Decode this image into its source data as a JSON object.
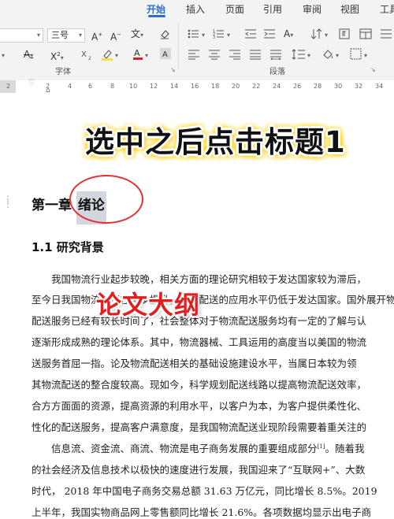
{
  "tabs": [
    {
      "label": "开始",
      "active": true
    },
    {
      "label": "插入",
      "active": false
    },
    {
      "label": "页面",
      "active": false
    },
    {
      "label": "引用",
      "active": false
    },
    {
      "label": "审阅",
      "active": false
    },
    {
      "label": "视图",
      "active": false
    },
    {
      "label": "工具",
      "active": false
    }
  ],
  "ribbon": {
    "font_size": "三号",
    "font_group_label": "字体",
    "paragraph_group_label": "段落",
    "icons": [
      "increase-font-icon",
      "decrease-font-icon",
      "phonetic-guide-icon",
      "clear-format-icon",
      "bullet-list-icon",
      "numbered-list-icon",
      "decrease-indent-icon",
      "increase-indent-icon",
      "text-direction-icon",
      "sort-icon",
      "show-marks-icon",
      "strikethrough-icon",
      "superscript-icon",
      "highlight-icon",
      "font-color-icon",
      "char-shading-icon",
      "align-left-icon",
      "align-center-icon",
      "align-right-icon",
      "justify-icon",
      "distributed-icon",
      "line-spacing-icon",
      "shading-icon",
      "border-icon"
    ],
    "font_color": "#e02020",
    "highlight_color": "#f5e04a"
  },
  "ruler": {
    "ticks": [
      "2",
      "2",
      "4",
      "6",
      "8",
      "10",
      "12",
      "14",
      "16",
      "18",
      "20",
      "22",
      "24",
      "26",
      "28",
      "30",
      "32",
      "34"
    ]
  },
  "overlay_title": "选中之后点击标题1",
  "overlay_red": "论文大纲",
  "document": {
    "chapter_prefix": "第一章",
    "chapter_selected": "绪论",
    "section": "1.1  研究背景",
    "paragraphs": [
      "　　我国物流行业起步较晚，相关方面的理论研究相较于发达国家较为滞后，",
      "至今日我国物流水平在逐步提升，物流配送的应用水平仍低于发达国家。国外展开物",
      "配送服务已经有较长时间了，社会整体对于物流配送服务均有一定的了解与认",
      "逐渐形成成熟的理论体系。其中，物流器械、工具运用的高度当以美国的物流",
      "送服务首屈一指。论及物流配送相关的基础设施建设水平，当属日本较为领",
      "其物流配送的整合度较高。现如今，科学规划配送线路以提高物流配送效率，",
      "合方方面面的资源，提高资源的利用水平，以客户为本，为客户提供柔性化、",
      "性化的配送服务，提高客户满意度，是我国物流配送业现阶段需要着重关注的",
      "　　信息流、资金流、商流、物流是电子商务发展的重要组成部分",
      "的社会经济及信息技术以极快的速度进行发展，我国迎来了“互联网+”、大数",
      "时代， 2018 年中国电子商务交易总额 31.63 万亿元，同比增长 8.5%。2019",
      "上半年，我国实物商品网上零售额同比增长 21.6%。各项数据均显示出电子商"
    ],
    "citation": "[1]",
    "para9_tail": "。随着我"
  }
}
